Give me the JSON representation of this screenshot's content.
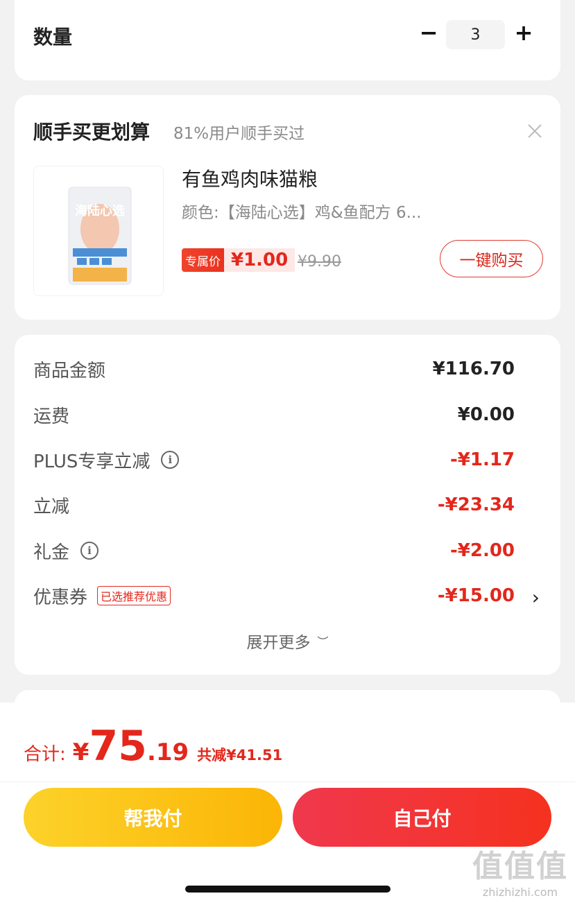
{
  "quantity": {
    "label": "数量",
    "minus": "−",
    "value": "3",
    "plus": "+"
  },
  "bundle": {
    "title": "顺手买更划算",
    "subtitle": "81%用户顺手买过",
    "product": {
      "name": "有鱼鸡肉味猫粮",
      "spec": "颜色:【海陆心选】鸡&鱼配方 6...",
      "price_tag_label": "专属价",
      "price": "¥1.00",
      "original_price": "¥9.90",
      "buy_button": "一键购买",
      "image_text": "海陆心选"
    }
  },
  "price_detail": {
    "rows": [
      {
        "label": "商品金额",
        "value": "¥116.70",
        "info_icon": false,
        "red": false
      },
      {
        "label": "运费",
        "value": "¥0.00",
        "info_icon": false,
        "red": false
      },
      {
        "label": "PLUS专享立减",
        "value": "-¥1.17",
        "info_icon": true,
        "red": true
      },
      {
        "label": "立减",
        "value": "-¥23.34",
        "info_icon": false,
        "red": true
      },
      {
        "label": "礼金",
        "value": "-¥2.00",
        "info_icon": true,
        "red": true
      },
      {
        "label": "优惠券",
        "value": "-¥15.00",
        "info_icon": false,
        "red": true
      }
    ],
    "coupon_badge": "已选推荐优惠",
    "expand_label": "展开更多"
  },
  "footer": {
    "total_label": "合计:",
    "currency": "¥",
    "total_int": "75",
    "total_dec": ".19",
    "saved": "共减¥41.51",
    "help_pay": "帮我付",
    "self_pay": "自己付"
  },
  "watermark": {
    "logo": "值值值",
    "url": "zhizhizhi.com"
  },
  "colors": {
    "accent_red": "#e3271b",
    "yellow_button": "#fbb506",
    "red_button": "#f0384e"
  }
}
